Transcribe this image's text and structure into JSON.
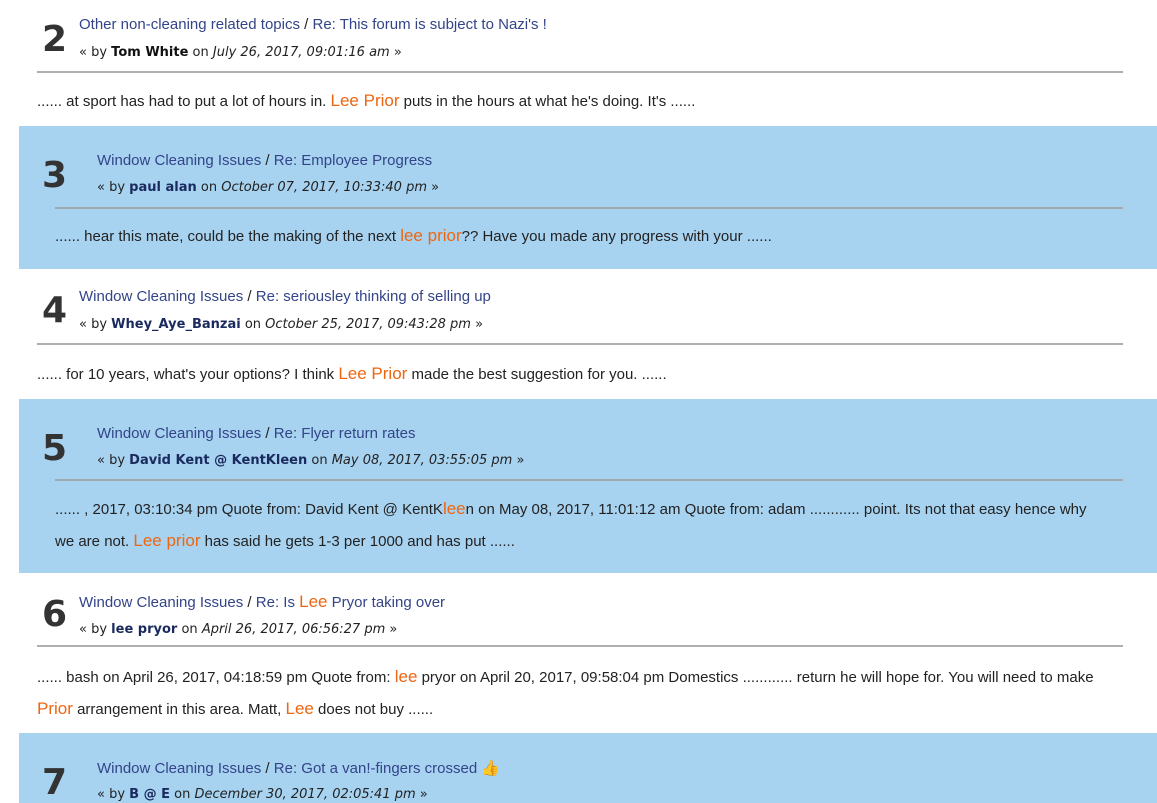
{
  "results": [
    {
      "number": "2",
      "board": "Other non-cleaning related topics",
      "separator": "/",
      "topic": "Re: This forum is subject to Nazi's !",
      "by_prefix": "« by",
      "author": "Tom White",
      "on": "on",
      "date": "July 26, 2017, 09:01:16 am",
      "suffix": "»",
      "snippet": [
        {
          "t": "......  at sport has had to put a lot of hours in. "
        },
        {
          "t": "Lee Prior",
          "hl": true
        },
        {
          "t": " puts in the hours at what he's doing.  It's  ......"
        }
      ]
    },
    {
      "number": "3",
      "board": "Window Cleaning Issues",
      "separator": "/",
      "topic": "Re: Employee Progress",
      "by_prefix": "« by",
      "author": "paul alan",
      "on": "on",
      "date": "October 07, 2017, 10:33:40 pm",
      "suffix": "»",
      "snippet": [
        {
          "t": "......  hear this mate, could be the making of the next "
        },
        {
          "t": "lee prior",
          "hl": true
        },
        {
          "t": "??  Have you made any progress with your  ......"
        }
      ]
    },
    {
      "number": "4",
      "board": "Window Cleaning Issues",
      "separator": "/",
      "topic": "Re: seriousley thinking of selling up",
      "by_prefix": "« by",
      "author": "Whey_Aye_Banzai",
      "on": "on",
      "date": "October 25, 2017, 09:43:28 pm",
      "suffix": "»",
      "snippet": [
        {
          "t": "......  for 10 years, what's your options?  I think "
        },
        {
          "t": "Lee Prior",
          "hl": true
        },
        {
          "t": " made the best suggestion for you.  ......"
        }
      ]
    },
    {
      "number": "5",
      "board": "Window Cleaning Issues",
      "separator": "/",
      "topic": "Re: Flyer return rates",
      "by_prefix": "« by",
      "author": "David Kent @ KentKleen",
      "on": "on",
      "date": "May 08, 2017, 03:55:05 pm",
      "suffix": "»",
      "snippet": [
        {
          "t": "...... , 2017, 03:10:34 pm  Quote from: David Kent @ KentK"
        },
        {
          "t": "lee",
          "hl": true
        },
        {
          "t": "n on May 08, 2017, 11:01:12 am  Quote from: adam  ............  point. Its not that easy hence why we are not.  "
        },
        {
          "t": "Lee prior",
          "hl": true
        },
        {
          "t": " has said he gets 1-3 per 1000 and has put  ......"
        }
      ]
    },
    {
      "number": "6",
      "board": "Window Cleaning Issues",
      "separator": "/",
      "topic_parts": [
        {
          "t": "Re: Is "
        },
        {
          "t": "Lee",
          "hl": true
        },
        {
          "t": " Pryor taking over"
        }
      ],
      "by_prefix": "« by",
      "author": "lee pryor",
      "on": "on",
      "date": "April 26, 2017, 06:56:27 pm",
      "suffix": "»",
      "snippet": [
        {
          "t": "......  bash on April 26, 2017, 04:18:59 pm  Quote from: "
        },
        {
          "t": "lee",
          "hl": true
        },
        {
          "t": " pryor on April 20, 2017, 09:58:04 pm  Domestics  ............  return he will hope for. You will need to make "
        },
        {
          "t": "Prior",
          "hl": true
        },
        {
          "t": " arrangement in this area. Matt, "
        },
        {
          "t": "Lee",
          "hl": true
        },
        {
          "t": " does not buy  ......"
        }
      ]
    },
    {
      "number": "7",
      "board": "Window Cleaning Issues",
      "separator": "/",
      "topic": "Re: Got a van!-fingers crossed",
      "topic_icon": "thumbs-up-icon",
      "by_prefix": "« by",
      "author": "B @ E",
      "on": "on",
      "date": "December 30, 2017, 02:05:41 pm",
      "suffix": "»"
    }
  ]
}
